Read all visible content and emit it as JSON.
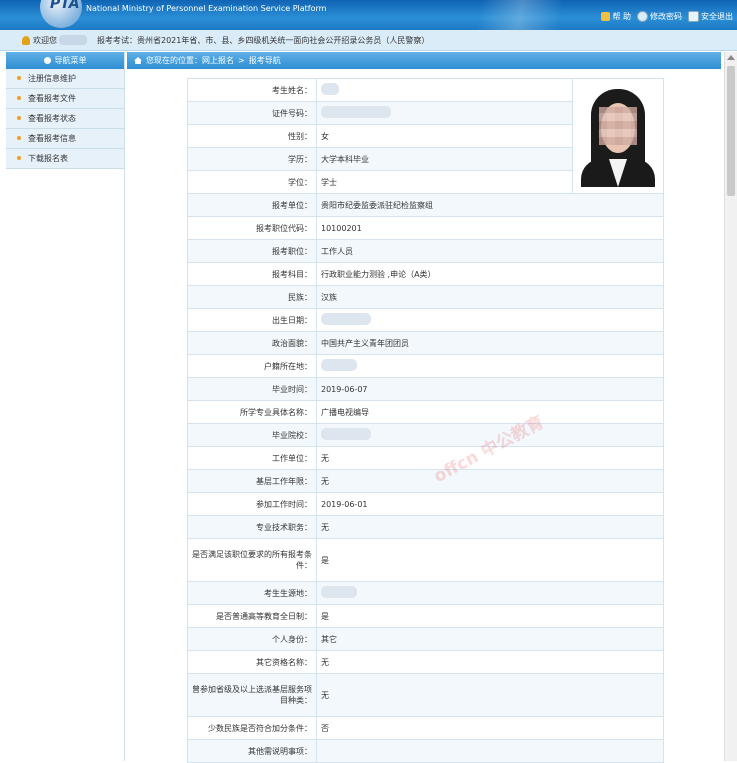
{
  "header": {
    "logo_text": "PTA",
    "english_name": "National Ministry of Personnel Examination Service Platform",
    "links": [
      {
        "label": "帮 助",
        "icon": "help-icon"
      },
      {
        "label": "修改密码",
        "icon": "password-icon"
      },
      {
        "label": "安全退出",
        "icon": "logout-icon"
      }
    ]
  },
  "welcome": {
    "greeting": "欢迎您",
    "exam": "报考考试：贵州省2021年省、市、县、乡四级机关统一面向社会公开招录公务员（人民警察）"
  },
  "sidebar": {
    "title": "导航菜单",
    "items": [
      {
        "label": "注册信息维护"
      },
      {
        "label": "查看报考文件"
      },
      {
        "label": "查看报考状态"
      },
      {
        "label": "查看报考信息"
      },
      {
        "label": "下载报名表"
      }
    ]
  },
  "breadcrumb": {
    "prefix": "您现在的位置：网上报名",
    "separator": ">",
    "current": "报考导航"
  },
  "form": {
    "rows": [
      {
        "label": "考生姓名：",
        "value": ""
      },
      {
        "label": "证件号码：",
        "value": ""
      },
      {
        "label": "性别：",
        "value": "女"
      },
      {
        "label": "学历：",
        "value": "大学本科毕业"
      },
      {
        "label": "学位：",
        "value": "学士"
      },
      {
        "label": "报考单位：",
        "value": "贵阳市纪委监委派驻纪检监察组"
      },
      {
        "label": "报考职位代码：",
        "value": "10100201"
      },
      {
        "label": "报考职位：",
        "value": "工作人员"
      },
      {
        "label": "报考科目：",
        "value": "行政职业能力测验 ,申论（A类）"
      },
      {
        "label": "民族：",
        "value": "汉族"
      },
      {
        "label": "出生日期：",
        "value": ""
      },
      {
        "label": "政治面貌：",
        "value": "中国共产主义青年团团员"
      },
      {
        "label": "户籍所在地：",
        "value": ""
      },
      {
        "label": "毕业时间：",
        "value": "2019-06-07"
      },
      {
        "label": "所学专业具体名称：",
        "value": "广播电视编导"
      },
      {
        "label": "毕业院校：",
        "value": ""
      },
      {
        "label": "工作单位：",
        "value": "无"
      },
      {
        "label": "基层工作年限：",
        "value": "无"
      },
      {
        "label": "参加工作时间：",
        "value": "2019-06-01"
      },
      {
        "label": "专业技术职务：",
        "value": "无"
      },
      {
        "label": "是否满足该职位要求的所有报考条件：",
        "value": "是"
      },
      {
        "label": "考生生源地：",
        "value": ""
      },
      {
        "label": "是否普通高等教育全日制：",
        "value": "是"
      },
      {
        "label": "个人身份：",
        "value": "其它"
      },
      {
        "label": "其它资格名称：",
        "value": "无"
      },
      {
        "label": "曾参加省级及以上选派基层服务项目种类：",
        "value": "无"
      },
      {
        "label": "少数民族是否符合加分条件：",
        "value": "否"
      },
      {
        "label": "其他需说明事项：",
        "value": ""
      }
    ]
  },
  "watermark": "offcn 中公教育"
}
